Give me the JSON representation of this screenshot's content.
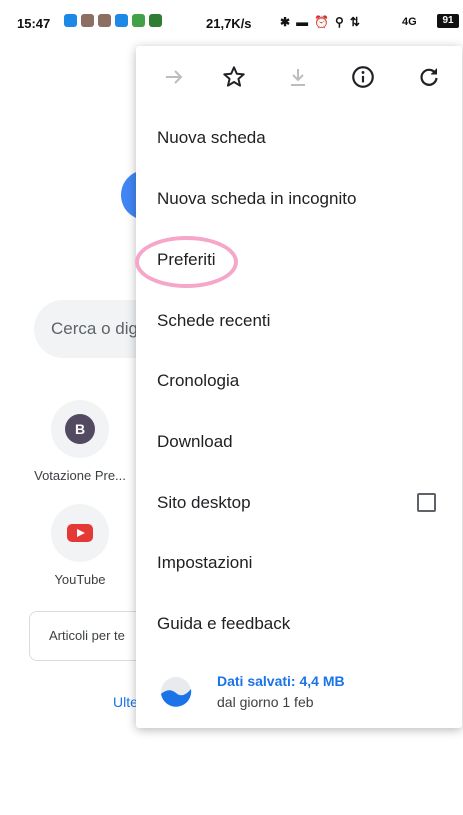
{
  "status_bar": {
    "time": "15:47",
    "net_speed": "21,7K/s",
    "network": "4G",
    "battery": "91",
    "app_icon_colors": [
      "#1e88e5",
      "#8d6e63",
      "#8d6e63",
      "#1e88e5",
      "#43a047",
      "#2e7d32"
    ]
  },
  "background": {
    "search_placeholder": "Cerca o dig",
    "tiles": [
      {
        "label": "Votazione Pre...",
        "badge": "B"
      },
      {
        "label": "YouTube"
      }
    ],
    "articles_label": "Articoli per te",
    "more_link": "Ulte"
  },
  "menu": {
    "icons": [
      "forward-icon",
      "star-icon",
      "download-icon",
      "info-icon",
      "refresh-icon"
    ],
    "items": [
      {
        "label": "Nuova scheda"
      },
      {
        "label": "Nuova scheda in incognito"
      },
      {
        "label": "Preferiti"
      },
      {
        "label": "Schede recenti"
      },
      {
        "label": "Cronologia"
      },
      {
        "label": "Download"
      },
      {
        "label": "Sito desktop",
        "checked": false
      },
      {
        "label": "Impostazioni"
      },
      {
        "label": "Guida e feedback"
      }
    ],
    "data_saved": {
      "title": "Dati salvati: 4,4 MB",
      "subtitle": "dal giorno 1 feb"
    }
  },
  "colors": {
    "accent": "#1a73e8",
    "highlight": "#f6a6c9"
  }
}
